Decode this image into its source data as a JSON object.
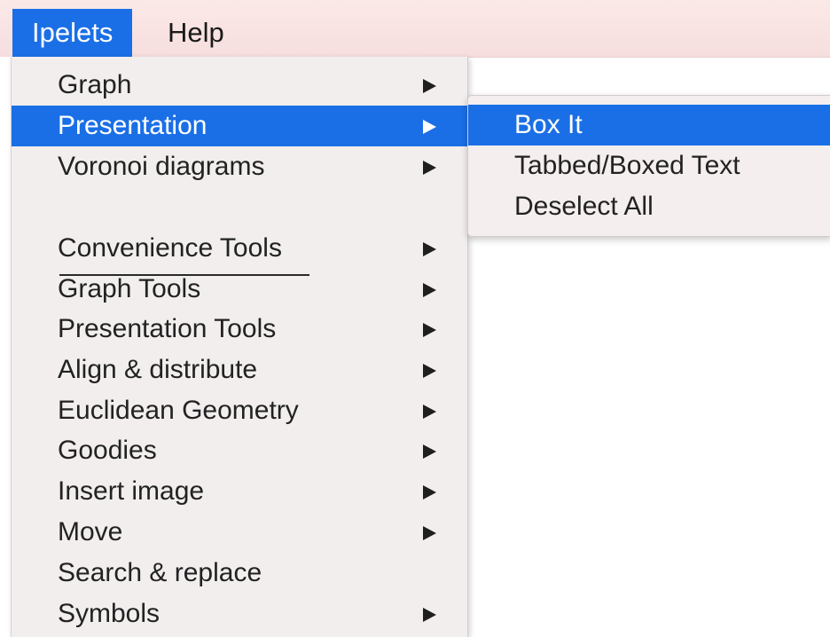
{
  "menubar": {
    "items": [
      {
        "label": "Ipelets",
        "active": true
      },
      {
        "label": "Help",
        "active": false
      }
    ]
  },
  "menu": {
    "items": [
      {
        "label": "Graph",
        "submenu": true
      },
      {
        "label": "Presentation",
        "submenu": true,
        "active": true
      },
      {
        "label": "Voronoi diagrams",
        "submenu": true
      },
      {
        "label": "Convenience Tools",
        "submenu": true
      },
      {
        "label": "Graph Tools",
        "submenu": true
      },
      {
        "label": "Presentation Tools",
        "submenu": true
      },
      {
        "label": "Align & distribute",
        "submenu": true
      },
      {
        "label": "Euclidean Geometry",
        "submenu": true
      },
      {
        "label": "Goodies",
        "submenu": true
      },
      {
        "label": "Insert image",
        "submenu": true
      },
      {
        "label": "Move",
        "submenu": true
      },
      {
        "label": "Search & replace",
        "submenu": false
      },
      {
        "label": "Symbols",
        "submenu": true
      }
    ]
  },
  "submenu": {
    "items": [
      {
        "label": "Box It",
        "active": true
      },
      {
        "label": "Tabbed/Boxed Text"
      },
      {
        "label": "Deselect All"
      }
    ]
  },
  "colors": {
    "highlight": "#1a6fe6",
    "menu_bg": "#f2eeee",
    "menubar_bg": "#f8e4e2"
  },
  "icons": {
    "submenu_arrow": "triangle-right-icon"
  }
}
